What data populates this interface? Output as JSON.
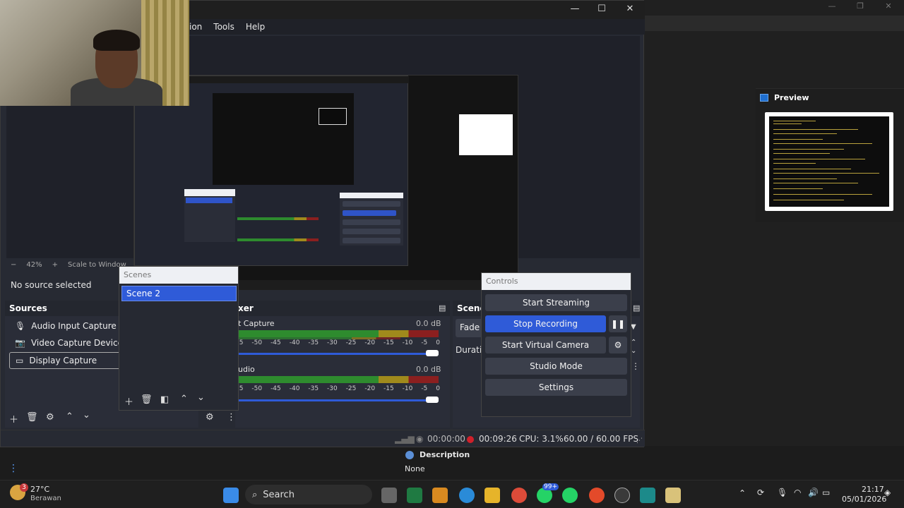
{
  "menu": {
    "items": [
      "ion",
      "Tools",
      "Help"
    ]
  },
  "zoom": {
    "minus": "−",
    "value": "42%",
    "plus": "+",
    "scale_mode": "Scale to Window"
  },
  "source_status": "No source selected",
  "sources": {
    "title": "Sources",
    "items": [
      "Audio Input Capture",
      "Video Capture Device",
      "Display Capture"
    ]
  },
  "scenes": {
    "title": "Scenes",
    "items": [
      "Scene 2"
    ]
  },
  "mixer": {
    "title": "xer",
    "tracks": [
      {
        "name": "t Capture",
        "db": "0.0 dB"
      },
      {
        "name": "udio",
        "db": "0.0 dB"
      }
    ],
    "ticks": [
      "55",
      "-50",
      "-45",
      "-40",
      "-35",
      "-30",
      "-25",
      "-20",
      "-15",
      "-10",
      "-5",
      "0"
    ]
  },
  "transitions": {
    "title": "Scene",
    "fade": "Fade",
    "duration": "Duratio"
  },
  "controls": {
    "title": "Controls",
    "start_streaming": "Start Streaming",
    "stop_recording": "Stop Recording",
    "start_virtual_camera": "Start Virtual Camera",
    "studio_mode": "Studio Mode",
    "settings": "Settings"
  },
  "status": {
    "stream_time": "00:00:00",
    "rec_time": "00:09:26",
    "cpu": "CPU: 3.1%",
    "fps": "60.00 / 60.00 FPS"
  },
  "preview_pane": {
    "title": "Preview"
  },
  "description": {
    "title": "Description",
    "value": "None"
  },
  "taskbar": {
    "weather_temp": "27°C",
    "weather_desc": "Berawan",
    "weather_badge": "3",
    "search_label": "Search",
    "whatsapp_badge": "99+",
    "time": "21:17",
    "date": "05/01/2026"
  },
  "colors": {
    "accent": "#2f5bd8",
    "record": "#d0202a",
    "panel": "#2a2d38"
  }
}
